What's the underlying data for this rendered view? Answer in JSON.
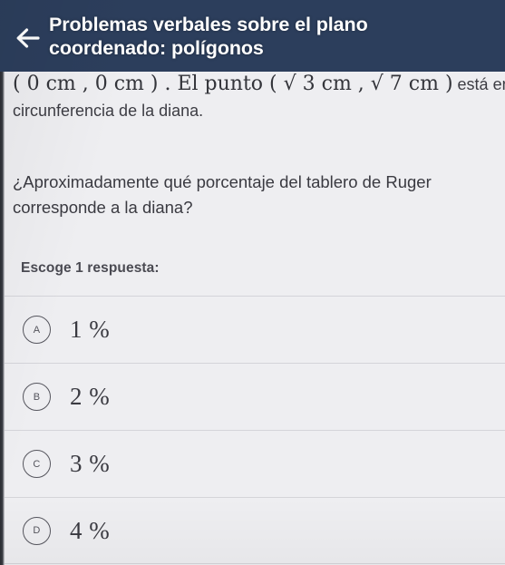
{
  "header": {
    "back_icon": "back-arrow-icon",
    "title": "Problemas verbales sobre el plano coordenado: polígonos",
    "bg_color": "#2c3e5c",
    "text_color": "#ffffff"
  },
  "stem": {
    "math_line_1": "( 0 cm , 0 cm ) . El punto ( √ 3 cm , √ 7 cm )",
    "math_line_1_tail": " está en la",
    "line_2": "circunferencia de la diana."
  },
  "question": {
    "text": "¿Aproximadamente qué porcentaje del tablero de Ruger corresponde a la diana?"
  },
  "answers": {
    "instruction": "Escoge 1 respuesta:",
    "options": [
      {
        "key": "A",
        "label": "1 %"
      },
      {
        "key": "B",
        "label": "2 %"
      },
      {
        "key": "C",
        "label": "3 %"
      },
      {
        "key": "D",
        "label": "4 %"
      }
    ]
  },
  "colors": {
    "page_bg": "#eeeef1",
    "divider": "#d4d4d9",
    "body_text": "#3a3a41"
  }
}
